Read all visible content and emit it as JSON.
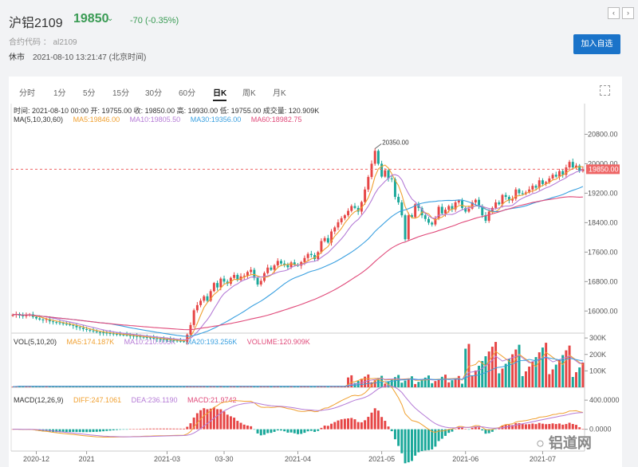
{
  "header": {
    "title": "沪铝2109",
    "price": "19850",
    "change": "-70 (-0.35%)",
    "code": "合约代码 ： al2109",
    "status": "休市",
    "datetime": "2021-08-10 13:21:47 (北京时间)",
    "add_label": "加入自选"
  },
  "colors": {
    "up": "#e64545",
    "down": "#1aa89a",
    "ma5": "#f0a030",
    "ma10": "#b57bd6",
    "ma30": "#3aa0e0",
    "ma60": "#e04a7a",
    "price_line": "#e66"
  },
  "tabs": [
    {
      "label": "分时"
    },
    {
      "label": "1分"
    },
    {
      "label": "5分"
    },
    {
      "label": "15分"
    },
    {
      "label": "30分"
    },
    {
      "label": "60分"
    },
    {
      "label": "日K",
      "active": true
    },
    {
      "label": "周K"
    },
    {
      "label": "月K"
    }
  ],
  "info": "时间: 2021-08-10 00:00    开: 19755.00    收: 19850.00    高: 19930.00    低: 19755.00    成交量: 120.909K",
  "ma": {
    "name": "MA(5,10,30,60)",
    "ma5": "MA5:19846.00",
    "ma10": "MA10:19805.50",
    "ma30": "MA30:19356.00",
    "ma60": "MA60:18982.75"
  },
  "vol": {
    "name": "VOL(5,10,20)",
    "ma5": "MA5:174.187K",
    "ma10": "MA10:210.005K",
    "ma20": "MA20:193.256K",
    "volume": "VOLUME:120.909K"
  },
  "macd": {
    "name": "MACD(12,26,9)",
    "diff": "DIFF:247.1061",
    "dea": "DEA:236.1190",
    "macd": "MACD:21.9742"
  },
  "chart_data": [
    {
      "type": "candlestick",
      "title": "",
      "y_ticks": [
        20800,
        20000,
        19200,
        18400,
        17600,
        16800,
        16000
      ],
      "ylim": [
        15400,
        21200
      ],
      "current_price": 19850,
      "peak_label": "20350.00",
      "x_ticks": [
        "2020-12",
        "2021",
        "2021-03",
        "03-30",
        "2021-04",
        "2021-05",
        "2021-06",
        "2021-07"
      ],
      "close": [
        15900,
        15920,
        15880,
        15860,
        15900,
        15910,
        15840,
        15800,
        15770,
        15760,
        15780,
        15720,
        15700,
        15690,
        15670,
        15650,
        15640,
        15620,
        15600,
        15560,
        15540,
        15510,
        15490,
        15470,
        15450,
        15430,
        15420,
        15410,
        15400,
        15390,
        15380,
        15370,
        15360,
        15350,
        15340,
        15330,
        15320,
        15310,
        15300,
        15290,
        15280,
        15270,
        15260,
        15250,
        15240,
        15230,
        15220,
        15210,
        15200,
        15190,
        15180,
        15170,
        15360,
        15620,
        16020,
        16160,
        16280,
        16400,
        16280,
        16540,
        16760,
        16640,
        16880,
        16800,
        16740,
        16900,
        16980,
        16840,
        16940,
        16960,
        17060,
        17120,
        16900,
        16720,
        16820,
        17030,
        17180,
        17120,
        17240,
        17360,
        17290,
        17250,
        17190,
        17320,
        17250,
        17230,
        17330,
        17440,
        17550,
        17520,
        17410,
        17600,
        17900,
        17980,
        17860,
        18160,
        18270,
        18410,
        18520,
        18600,
        18720,
        18850,
        18800,
        18700,
        18960,
        19300,
        19640,
        20000,
        20350,
        20000,
        19650,
        19820,
        19600,
        19580,
        19100,
        18950,
        18600,
        17950,
        18600,
        18550,
        18900,
        18800,
        18600,
        18500,
        18400,
        18350,
        18510,
        18830,
        18650,
        18750,
        18850,
        18760,
        18950,
        19000,
        18800,
        18700,
        18780,
        18950,
        19020,
        18850,
        18600,
        18450,
        18700,
        18800,
        18950,
        18900,
        19150,
        19100,
        19000,
        19050,
        19300,
        19200,
        19180,
        19220,
        19300,
        19400,
        19350,
        19550,
        19450,
        19500,
        19600,
        19700,
        19650,
        19800,
        19700,
        19900,
        20050,
        19900,
        19950,
        19800,
        19850
      ],
      "series": [
        {
          "name": "MA5",
          "value": "19846.00"
        },
        {
          "name": "MA10",
          "value": "19805.50"
        },
        {
          "name": "MA30",
          "value": "19356.00"
        },
        {
          "name": "MA60",
          "value": "18982.75"
        }
      ]
    },
    {
      "type": "bar",
      "title": "",
      "y_ticks": [
        "300K",
        "200K",
        "100K"
      ],
      "ylim": [
        0,
        320
      ]
    },
    {
      "type": "bar",
      "title": "",
      "y_ticks": [
        "400.0000",
        "0.0000"
      ],
      "ylim": [
        -300,
        500
      ]
    }
  ]
}
